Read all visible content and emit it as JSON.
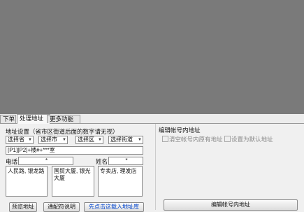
{
  "tabs": [
    {
      "label": "下单"
    },
    {
      "label": "处理地址"
    },
    {
      "label": "更多功能"
    }
  ],
  "address": {
    "section_label": "地址设置（省市区街道后面的数字请无视）",
    "province": "选择省",
    "city": "选择市",
    "district": "选择区",
    "street": "选择街道",
    "template_value": "[P1][P2]+楼#+***室",
    "phone_label": "电话",
    "phone_value": "*",
    "name_label": "姓名",
    "name_value": "*",
    "box1": "人民路, 银龙路",
    "box2": "国贸大厦, 银光大厦",
    "box3": "专卖店, 理发店"
  },
  "buttons": {
    "preview": "预览地址",
    "help": "通配符说明",
    "load": "先点击这载入地址库",
    "edit_address": "编辑帐号内地址"
  },
  "right": {
    "title": "编辑帐号内地址",
    "clear_label": "清空帐号内原有地址",
    "default_label": "设置为默认地址"
  }
}
